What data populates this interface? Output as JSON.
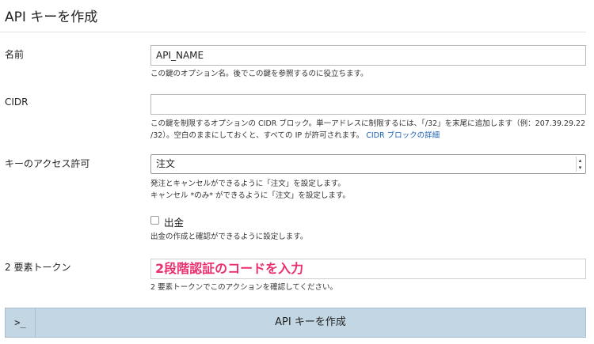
{
  "page": {
    "title": "API キーを作成"
  },
  "fields": {
    "name": {
      "label": "名前",
      "value": "API_NAME",
      "help": "この鍵のオプション名。後でこの鍵を参照するのに役立ちます。"
    },
    "cidr": {
      "label": "CIDR",
      "value": "",
      "help_line1": "この鍵を制限するオプションの CIDR ブロック。単一アドレスに制限するには、「/32」を末尾に追加します（例：207.39.29.22",
      "help_line2": "/32）。空白のままにしておくと、すべての IP が許可されます。",
      "help_link": "CIDR ブロックの詳細"
    },
    "access": {
      "label": "キーのアクセス許可",
      "selected": "注文",
      "help_line1": "発注とキャンセルができるように「注文」を設定します。",
      "help_line2": "キャンセル *のみ* ができるように「注文」を設定します。",
      "withdraw_label": "出金",
      "withdraw_checked": false,
      "withdraw_help": "出金の作成と確認ができるように設定します。"
    },
    "two_factor": {
      "label": "2 要素トークン",
      "annotation": "2段階認証のコードを入力",
      "help": "2 要素トークンでこのアクションを確認してください。"
    }
  },
  "submit": {
    "terminal_icon": "terminal-prompt-icon",
    "terminal_glyph": ">_",
    "label": "API キーを作成"
  },
  "colors": {
    "annotation": "#ea2f6d",
    "submit_bg": "#c3d6e4",
    "link": "#1a5fb4"
  }
}
